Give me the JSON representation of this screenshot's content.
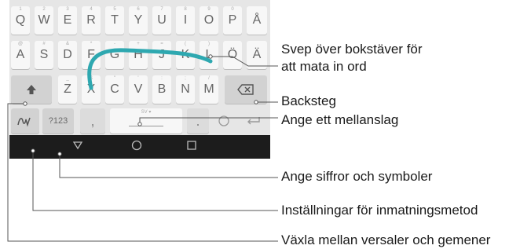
{
  "keyboard": {
    "row1": [
      {
        "label": "Q",
        "hint": "1"
      },
      {
        "label": "W",
        "hint": "2"
      },
      {
        "label": "E",
        "hint": "3"
      },
      {
        "label": "R",
        "hint": "4"
      },
      {
        "label": "T",
        "hint": "5"
      },
      {
        "label": "Y",
        "hint": "6"
      },
      {
        "label": "U",
        "hint": "7"
      },
      {
        "label": "I",
        "hint": "8"
      },
      {
        "label": "O",
        "hint": "9"
      },
      {
        "label": "P",
        "hint": "0"
      },
      {
        "label": "Å",
        "hint": ""
      }
    ],
    "row2": [
      {
        "label": "A",
        "hint": "@"
      },
      {
        "label": "S",
        "hint": "#"
      },
      {
        "label": "D",
        "hint": "&"
      },
      {
        "label": "F",
        "hint": "*"
      },
      {
        "label": "G",
        "hint": "-"
      },
      {
        "label": "H",
        "hint": "+"
      },
      {
        "label": "J",
        "hint": "="
      },
      {
        "label": "K",
        "hint": "("
      },
      {
        "label": "L",
        "hint": ")"
      },
      {
        "label": "Ö",
        "hint": ""
      },
      {
        "label": "Ä",
        "hint": ""
      }
    ],
    "row3": [
      {
        "label": "Z",
        "hint": "_"
      },
      {
        "label": "X",
        "hint": "$"
      },
      {
        "label": "C",
        "hint": "\""
      },
      {
        "label": "V",
        "hint": "'"
      },
      {
        "label": "B",
        "hint": ":"
      },
      {
        "label": "N",
        "hint": ";"
      },
      {
        "label": "M",
        "hint": "/"
      }
    ],
    "symbols_key_label": "?123",
    "comma_key_label": ",",
    "period_key_label": ".",
    "space_hint": "SV ▾"
  },
  "callouts": {
    "swipe_line1": "Svep över bokstäver för",
    "swipe_line2": "att mata in ord",
    "backspace": "Backsteg",
    "space": "Ange ett mellanslag",
    "symbols": "Ange siffror och symboler",
    "settings": "Inställningar för inmatningsmetod",
    "shift": "Växla mellan versaler och gemener"
  },
  "colors": {
    "accent": "#2ea8b0",
    "keyboard_bg": "#e6e6e6",
    "navbar_bg": "#1c1c1c"
  },
  "icons": [
    "shift-icon",
    "backspace-icon",
    "handwriting-settings-icon",
    "enter-icon",
    "back-nav-icon",
    "home-nav-icon",
    "recents-nav-icon"
  ]
}
